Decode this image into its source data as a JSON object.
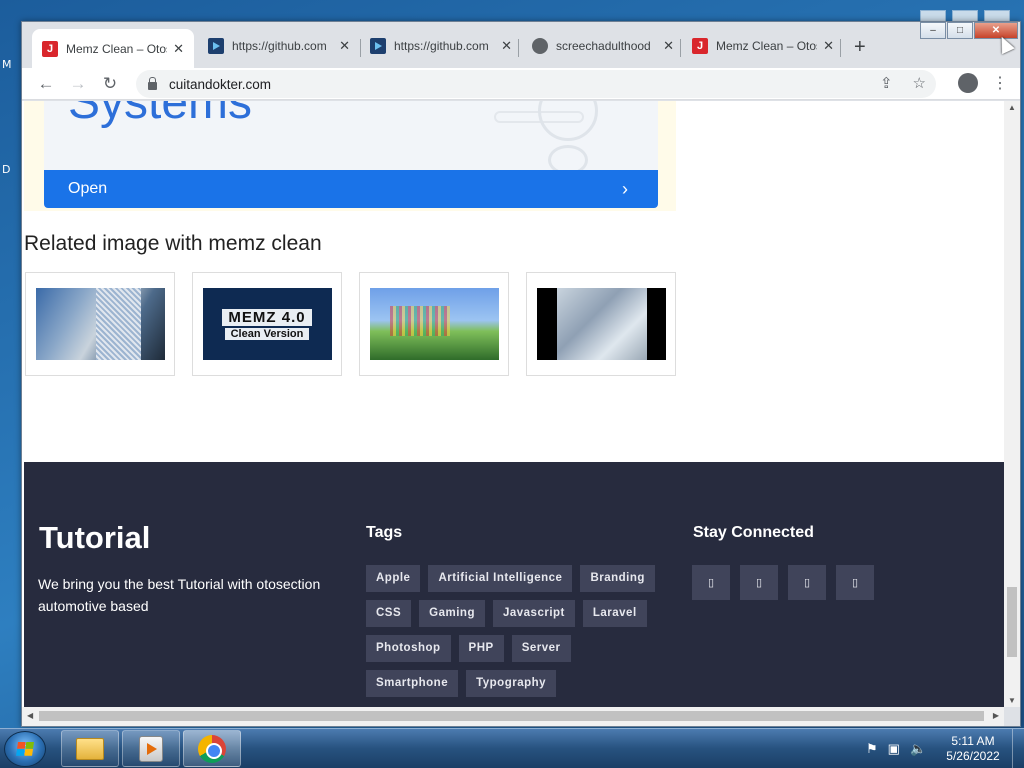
{
  "desktop": {
    "left_labels": [
      "M",
      "D"
    ]
  },
  "browser": {
    "tabs": [
      {
        "title": "Memz Clean – Otosection",
        "favicon": "j-icon",
        "active": true
      },
      {
        "title": "https://github.com",
        "favicon": "play-icon",
        "active": false
      },
      {
        "title": "https://github.com",
        "favicon": "play-icon",
        "active": false
      },
      {
        "title": "screechadulthood",
        "favicon": "globe-icon",
        "active": false
      },
      {
        "title": "Memz Clean – Otosection",
        "favicon": "j-icon",
        "active": false
      }
    ],
    "tab_close": "✕",
    "new_tab": "+",
    "url": "cuitandokter.com",
    "window_controls": {
      "minimize": "–",
      "maximize": "□",
      "close": "✕"
    }
  },
  "page": {
    "ad": {
      "heading": "Systems",
      "open_label": "Open",
      "chevron": "›"
    },
    "related_heading": "Related image with memz clean",
    "thumbnails": [
      {
        "alt": "memz-screenshot-1"
      },
      {
        "alt": "memz-4-clean-version",
        "line1": "MEMZ 4.0",
        "line2": "Clean Version"
      },
      {
        "alt": "memz-screenshot-3"
      },
      {
        "alt": "memz-screenshot-4"
      }
    ],
    "footer": {
      "brand": "Tutorial",
      "description": "We bring you the best Tutorial with otosection automotive based",
      "tags_title": "Tags",
      "tags": [
        "Apple",
        "Artificial Intelligence",
        "Branding",
        "CSS",
        "Gaming",
        "Javascript",
        "Laravel",
        "Photoshop",
        "PHP",
        "Server",
        "Smartphone",
        "Typography"
      ],
      "social_title": "Stay Connected",
      "social_icons": [
        "facebook-icon",
        "twitter-icon",
        "instagram-icon",
        "youtube-icon"
      ]
    }
  },
  "taskbar": {
    "clock_time": "5:11 AM",
    "clock_date": "5/26/2022"
  }
}
